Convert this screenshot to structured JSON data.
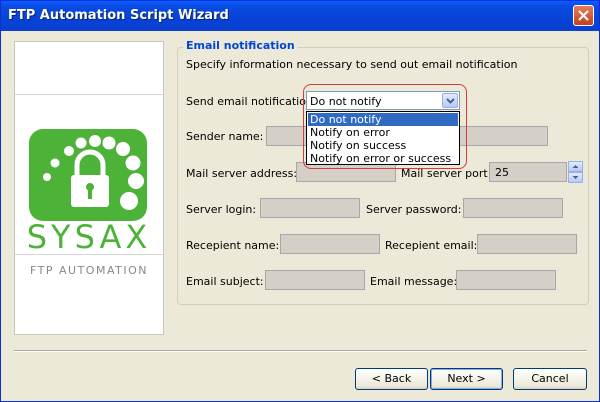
{
  "window": {
    "title": "FTP Automation Script Wizard"
  },
  "branding": {
    "name": "SYSAX",
    "tagline": "FTP AUTOMATION",
    "brand_color": "#4db338"
  },
  "group": {
    "title": "Email notification",
    "description": "Specify information necessary to send out email notification"
  },
  "form": {
    "send_label": "Send email notification:",
    "send_selected": "Do not notify",
    "send_options": [
      "Do not notify",
      "Notify on error",
      "Notify on success",
      "Notify on error or success"
    ],
    "sender_label": "Sender name:",
    "mail_server_label": "Mail server address:",
    "mail_port_label": "Mail server port:",
    "mail_port_value": "25",
    "login_label": "Server login:",
    "password_label": "Server password:",
    "recipient_name_label": "Recepient name:",
    "recipient_email_label": "Recepient email:",
    "subject_label": "Email subject:",
    "message_label": "Email message:"
  },
  "buttons": {
    "back": "< Back",
    "next": "Next >",
    "cancel": "Cancel"
  },
  "colors": {
    "title_blue": "#0046d5",
    "selection": "#316ac5",
    "highlight_ring": "#d43c3c"
  }
}
